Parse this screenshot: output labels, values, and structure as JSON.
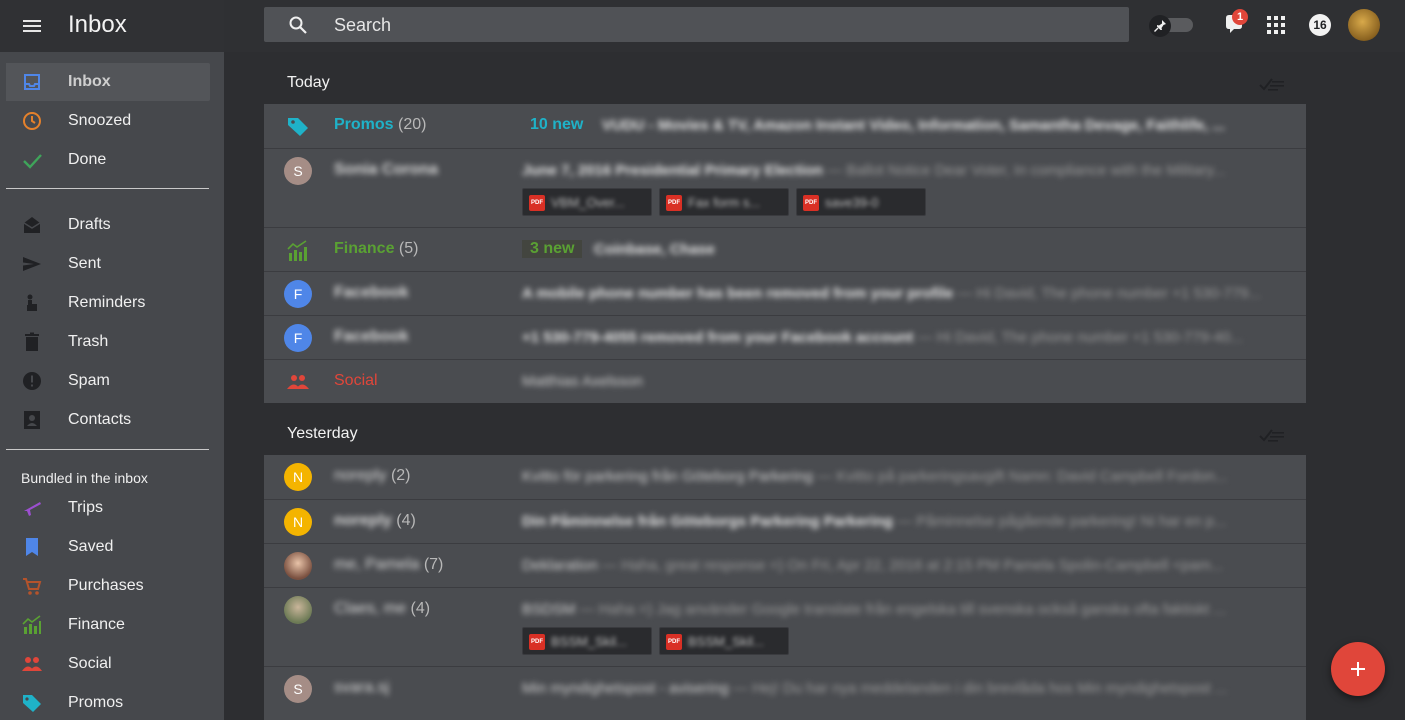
{
  "header": {
    "title": "Inbox",
    "search_placeholder": "Search",
    "notification_count": "1",
    "apps_count": "16"
  },
  "sidebar": {
    "primary": [
      {
        "label": "Inbox",
        "icon": "inbox-icon",
        "color": "#4f86e8"
      },
      {
        "label": "Snoozed",
        "icon": "clock-icon",
        "color": "#e5812b"
      },
      {
        "label": "Done",
        "icon": "check-icon",
        "color": "#3fa45a"
      }
    ],
    "secondary": [
      {
        "label": "Drafts",
        "icon": "drafts-icon"
      },
      {
        "label": "Sent",
        "icon": "send-icon"
      },
      {
        "label": "Reminders",
        "icon": "reminder-icon"
      },
      {
        "label": "Trash",
        "icon": "trash-icon"
      },
      {
        "label": "Spam",
        "icon": "spam-icon"
      },
      {
        "label": "Contacts",
        "icon": "contacts-icon"
      }
    ],
    "bundles_heading": "Bundled in the inbox",
    "bundles": [
      {
        "label": "Trips",
        "icon": "plane-icon",
        "color": "#9c4fd0"
      },
      {
        "label": "Saved",
        "icon": "bookmark-icon",
        "color": "#4f86e8"
      },
      {
        "label": "Purchases",
        "icon": "cart-icon",
        "color": "#b5532b"
      },
      {
        "label": "Finance",
        "icon": "finance-icon",
        "color": "#5aa133"
      },
      {
        "label": "Social",
        "icon": "people-icon",
        "color": "#e0463a"
      },
      {
        "label": "Promos",
        "icon": "tag-icon",
        "color": "#1fb2c8"
      }
    ]
  },
  "sections": {
    "today": "Today",
    "yesterday": "Yesterday"
  },
  "today": {
    "promos": {
      "label": "Promos",
      "count": "(20)",
      "new": "10 new",
      "senders": "VUDU - Movies & TV, Amazon Instant Video, Information, Samantha Devage, Faithlife, ..."
    },
    "sonia": {
      "initial": "S",
      "sender": "Sonia Corona",
      "subject": "June 7, 2016 Presidential Primary Election",
      "snippet": " — Ballot Notice Dear Voter, In compliance with the Military...",
      "attachments": [
        "VBM_Over...",
        "Fax form s...",
        "save39-0"
      ]
    },
    "finance": {
      "label": "Finance",
      "count": "(5)",
      "new": "3 new",
      "senders": "Coinbase, Chase"
    },
    "fb1": {
      "initial": "F",
      "sender": "Facebook",
      "subject": "A mobile phone number has been removed from your profile",
      "snippet": " — Hi David, The phone number +1 530-779..."
    },
    "fb2": {
      "initial": "F",
      "sender": "Facebook",
      "subject": "+1 530-779-4055 removed from your Facebook account",
      "snippet": " — Hi David, The phone number +1 530-779-40..."
    },
    "social": {
      "label": "Social",
      "senders": "Matthias Axelsson"
    }
  },
  "yesterday": {
    "r1": {
      "initial": "N",
      "sender": "noreply",
      "count": "(2)",
      "subject": "Kvitto för parkering från Göteborg Parkering",
      "snippet": " — Kvitto på parkeringsavgift Namn: David Campbell Fordon..."
    },
    "r2": {
      "initial": "N",
      "sender": "noreply",
      "count": "(4)",
      "subject": "Din Påminnelse från Göteborgs Parkering Parkering",
      "snippet": " — Påminnelse pågående parkering! Ni har en p..."
    },
    "r3": {
      "sender": "me, Pamela",
      "count": "(7)",
      "subject": "Deklaration",
      "snippet": " — Haha, great response =) On Fri, Apr 22, 2016 at 2:15 PM Pamela Spolin-Campbell <pam..."
    },
    "r4": {
      "sender": "Claes, me",
      "count": "(4)",
      "subject": "BSDSM",
      "snippet": " — Haha =) Jag använder Google translate från engelska till svenska också ganska ofta faktiskt ...",
      "attachments": [
        "BSSM_Skil...",
        "BSSM_Skil..."
      ]
    },
    "r5": {
      "initial": "S",
      "sender": "svara.sj",
      "subject": "Min myndighetspost - avisering",
      "snippet": " — Hej! Du har nya meddelanden i din brevlåda hos Min myndighetspost ..."
    }
  },
  "colors": {
    "promos": "#1fb2c8",
    "finance": "#5aa133",
    "social": "#e0463a",
    "fab": "#e0463a"
  }
}
